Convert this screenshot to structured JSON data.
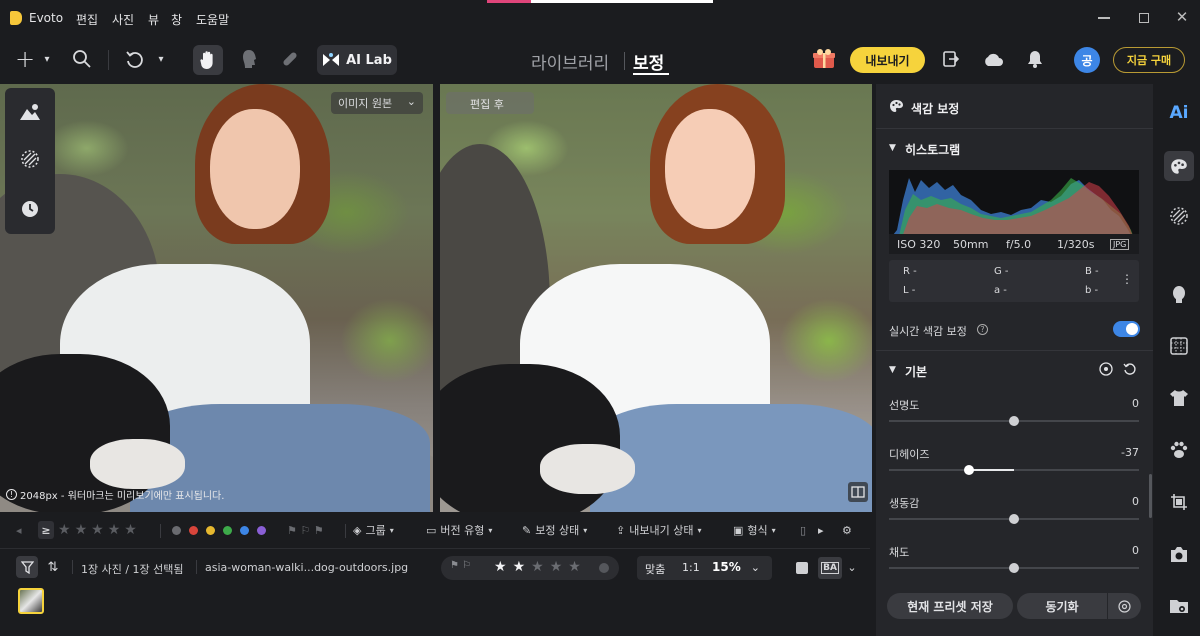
{
  "app": {
    "name": "Evoto",
    "menus": [
      "편집",
      "사진",
      "뷰",
      "창",
      "도움말"
    ]
  },
  "toolbar": {
    "ai_lab": "AI Lab",
    "tabs": [
      "라이브러리",
      "보정"
    ],
    "active_tab": "보정",
    "export_label": "내보내기",
    "avatar_initial": "공",
    "buy_label": "지금 구매"
  },
  "canvas": {
    "before_select": "이미지 원본",
    "after_label": "편집 후",
    "watermark_note": "2048px - 워터마크는 미리보기에만 표시됩니다."
  },
  "filterbar": {
    "ge": "≥",
    "group": "그룹",
    "version": "버전 유형",
    "status": "보정 상태",
    "export_status": "내보내기 상태",
    "format": "형식",
    "ellipsis": "",
    "colors": [
      "#6a6b70",
      "#d9453b",
      "#e6b82f",
      "#3daa4a",
      "#3d86e6",
      "#8a5fd6"
    ]
  },
  "statusbar": {
    "selection": "1장 사진 / 1장 선택됨",
    "filename": "asia-woman-walki...dog-outdoors.jpg",
    "rating": 2,
    "fit": "맞춤",
    "one_to_one": "1:1",
    "zoom": "15%"
  },
  "panel": {
    "title": "색감 보정",
    "histogram_title": "히스토그램",
    "exif": {
      "iso": "ISO 320",
      "focal": "50mm",
      "aperture": "f/5.0",
      "shutter": "1/320s",
      "format": "JPG"
    },
    "readout": {
      "r": "R -",
      "g": "G -",
      "b": "B -",
      "l": "L -",
      "a": "a -",
      "b2": "b -"
    },
    "realtime_label": "실시간 색감 보정",
    "basic_title": "기본",
    "sliders": [
      {
        "label": "선명도",
        "value": "0",
        "level": 0.5
      },
      {
        "label": "디헤이즈",
        "value": "-37",
        "level": 0.32
      },
      {
        "label": "생동감",
        "value": "0",
        "level": 0.5
      },
      {
        "label": "채도",
        "value": "0",
        "level": 0.5
      }
    ],
    "save_preset": "현재 프리셋 저장",
    "sync": "동기화"
  },
  "colors": {
    "accent_yellow": "#f6d33c",
    "accent_blue": "#3d86e6"
  }
}
